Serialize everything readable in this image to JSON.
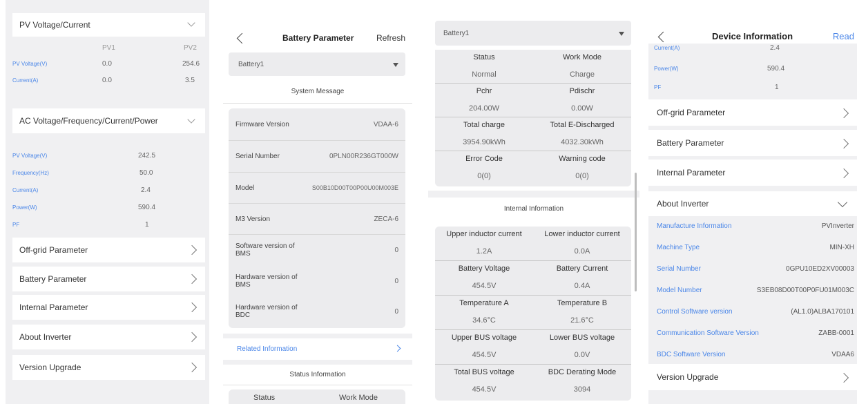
{
  "p1": {
    "pv_title": "PV Voltage/Current",
    "pv_head": [
      "PV1",
      "PV2"
    ],
    "pv_rows": [
      {
        "label": "PV Voltage(V)",
        "v1": "0.0",
        "v2": "254.6"
      },
      {
        "label": "Current(A)",
        "v1": "0.0",
        "v2": "3.5"
      }
    ],
    "ac_title": "AC Voltage/Frequency/Current/Power",
    "ac_rows": [
      {
        "label": "PV Voltage(V)",
        "value": "242.5"
      },
      {
        "label": "Frequency(Hz)",
        "value": "50.0"
      },
      {
        "label": "Current(A)",
        "value": "2.4"
      },
      {
        "label": "Power(W)",
        "value": "590.4"
      },
      {
        "label": "PF",
        "value": "1"
      }
    ],
    "menu": [
      "Off-grid Parameter",
      "Battery Parameter",
      "Internal Parameter",
      "About Inverter",
      "Version Upgrade"
    ]
  },
  "p2": {
    "title": "Battery Parameter",
    "refresh": "Refresh",
    "battery": "Battery1",
    "system_msg": "System Message",
    "rows": [
      {
        "label": "Firmware Version",
        "value": "VDAA-6"
      },
      {
        "label": "Serial Number",
        "value": "0PLN00R236GT000W"
      },
      {
        "label": "Model",
        "value": "S00B10D00T00P00U00M003E"
      },
      {
        "label": "M3 Version",
        "value": "ZECA-6"
      },
      {
        "label": "Software version of BMS",
        "value": "0"
      },
      {
        "label": "Hardware version of BMS",
        "value": "0"
      },
      {
        "label": "Hardware version of BDC",
        "value": "0"
      }
    ],
    "related": "Related Information",
    "status_info": "Status Information",
    "status_label": "Status",
    "work_mode_label": "Work Mode"
  },
  "p3": {
    "battery": "Battery1",
    "status_grid": [
      [
        "Status",
        "Work Mode"
      ],
      [
        "Normal",
        "Charge"
      ],
      [
        "Pchr",
        "Pdischr"
      ],
      [
        "204.00W",
        "0.00W"
      ],
      [
        "Total charge",
        "Total E-Discharged"
      ],
      [
        "3954.90kWh",
        "4032.30kWh"
      ],
      [
        "Error Code",
        "Warning code"
      ],
      [
        "0(0)",
        "0(0)"
      ]
    ],
    "internal_info": "Internal Information",
    "internal_grid": [
      [
        "Upper inductor current",
        "Lower inductor current"
      ],
      [
        "1.2A",
        "0.0A"
      ],
      [
        "Battery Voltage",
        "Battery Current"
      ],
      [
        "454.5V",
        "0.4A"
      ],
      [
        "Temperature A",
        "Temperature B"
      ],
      [
        "34.6°C",
        "21.6°C"
      ],
      [
        "Upper BUS voltage",
        "Lower BUS voltage"
      ],
      [
        "454.5V",
        "0.0V"
      ],
      [
        "Total BUS voltage",
        "BDC Derating Mode"
      ],
      [
        "454.5V",
        "3094"
      ]
    ]
  },
  "p4": {
    "title": "Device Information",
    "read": "Read",
    "top_rows": [
      {
        "label": "Current(A)",
        "value": "2.4"
      },
      {
        "label": "Power(W)",
        "value": "590.4"
      },
      {
        "label": "PF",
        "value": "1"
      }
    ],
    "menu": [
      "Off-grid Parameter",
      "Battery Parameter",
      "Internal Parameter"
    ],
    "about": "About Inverter",
    "about_rows": [
      {
        "label": "Manufacture Information",
        "value": "PVInverter"
      },
      {
        "label": "Machine Type",
        "value": "MIN-XH"
      },
      {
        "label": "Serial Number",
        "value": "0GPU10ED2XV00003"
      },
      {
        "label": "Model Number",
        "value": "S3EB08D00T00P0FU01M003C"
      },
      {
        "label": "Control Software version",
        "value": "(AL1.0)ALBA170101"
      },
      {
        "label": "Communication Software Version",
        "value": "ZABB-0001"
      },
      {
        "label": "BDC Software Version",
        "value": "VDAA6"
      }
    ],
    "version": "Version Upgrade"
  }
}
